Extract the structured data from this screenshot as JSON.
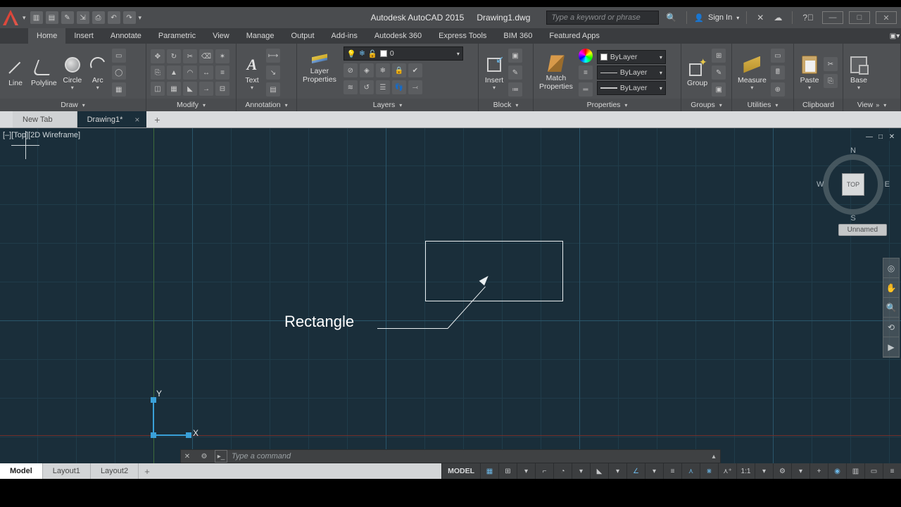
{
  "title": {
    "app": "Autodesk AutoCAD 2015",
    "file": "Drawing1.dwg"
  },
  "search": {
    "placeholder": "Type a keyword or phrase"
  },
  "signin": "Sign In",
  "tabs": [
    "Home",
    "Insert",
    "Annotate",
    "Parametric",
    "View",
    "Manage",
    "Output",
    "Add-ins",
    "Autodesk 360",
    "Express Tools",
    "BIM 360",
    "Featured Apps"
  ],
  "active_tab": "Home",
  "panels": {
    "draw": {
      "title": "Draw",
      "items": [
        "Line",
        "Polyline",
        "Circle",
        "Arc"
      ]
    },
    "modify": {
      "title": "Modify"
    },
    "annotation": {
      "title": "Annotation",
      "text_btn": "Text"
    },
    "layers": {
      "title": "Layers",
      "props_btn": "Layer\nProperties",
      "current": "0"
    },
    "block": {
      "title": "Block",
      "insert_btn": "Insert"
    },
    "properties": {
      "title": "Properties",
      "match_btn": "Match\nProperties",
      "bycolor": "ByLayer",
      "byline": "ByLayer",
      "bylwt": "ByLayer"
    },
    "groups": {
      "title": "Groups",
      "group_btn": "Group"
    },
    "utilities": {
      "title": "Utilities",
      "measure_btn": "Measure"
    },
    "clipboard": {
      "title": "Clipboard",
      "paste_btn": "Paste"
    },
    "view": {
      "title": "View",
      "base_btn": "Base"
    }
  },
  "filetabs": {
    "items": [
      "New Tab",
      "Drawing1*"
    ],
    "active": "Drawing1*"
  },
  "viewport": {
    "label": "[–][Top][2D Wireframe]"
  },
  "viewcube": {
    "face": "TOP",
    "n": "N",
    "s": "S",
    "e": "E",
    "w": "W",
    "wcs": "Unnamed"
  },
  "canvas": {
    "annotation": "Rectangle",
    "ucs": {
      "x": "X",
      "y": "Y"
    }
  },
  "command": {
    "placeholder": "Type a command"
  },
  "layout": {
    "tabs": [
      "Model",
      "Layout1",
      "Layout2"
    ],
    "active": "Model"
  },
  "status": {
    "model": "MODEL",
    "scale": "1:1"
  }
}
